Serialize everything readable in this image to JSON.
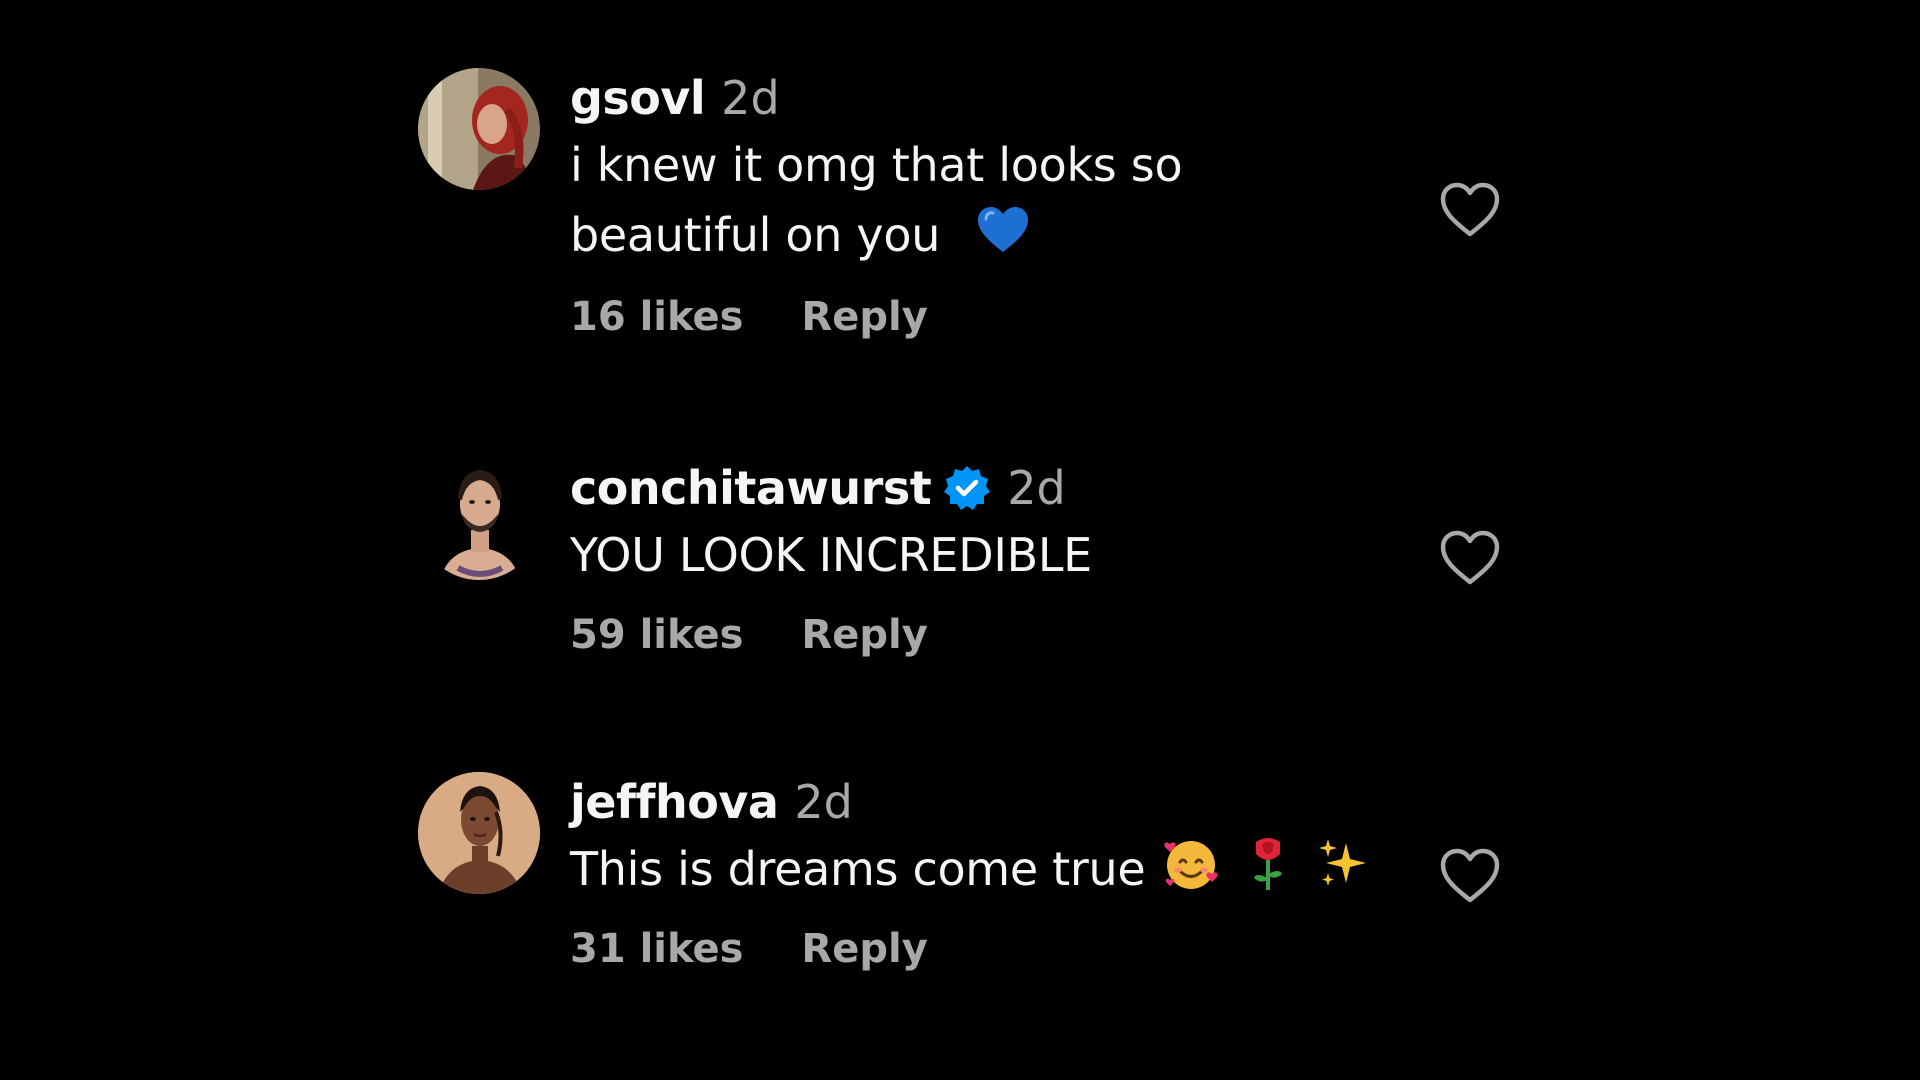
{
  "comments": [
    {
      "username": "gsovl",
      "time": "2d",
      "text_line1": "i knew it omg that looks so",
      "text_line2": "beautiful on you",
      "emojis": [
        "blue-heart"
      ],
      "likes": "16 likes",
      "reply": "Reply",
      "verified": false
    },
    {
      "username": "conchitawurst",
      "time": "2d",
      "text_line1": "YOU LOOK INCREDIBLE",
      "likes": "59 likes",
      "reply": "Reply",
      "verified": true
    },
    {
      "username": "jeffhova",
      "time": "2d",
      "text_line1": "This is dreams come true",
      "emojis": [
        "smiling-face-with-hearts",
        "rose",
        "sparkles"
      ],
      "likes": "31 likes",
      "reply": "Reply",
      "verified": false
    }
  ],
  "colors": {
    "background": "#000000",
    "primary_text": "#f5f5f5",
    "secondary_text": "#a8a8a8",
    "verified_badge": "#0095f6",
    "icon_stroke": "#a8a8a8"
  }
}
